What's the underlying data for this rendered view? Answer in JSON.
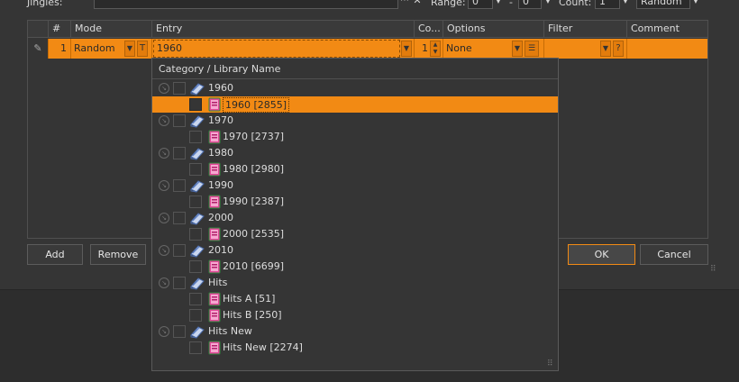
{
  "top": {
    "jingles_label": "Jingles:",
    "range_label": "Range:",
    "range_from": "0",
    "range_sep": "-",
    "range_to": "0",
    "count_label": "Count:",
    "count_value": "1",
    "mode_value": "Random"
  },
  "grid": {
    "headers": {
      "num": "#",
      "mode": "Mode",
      "entry": "Entry",
      "count": "Co...",
      "options": "Options",
      "filter": "Filter",
      "comment": "Comment"
    },
    "row": {
      "num": "1",
      "mode": "Random",
      "type": "T",
      "entry": "1960",
      "count": "1",
      "options": "None",
      "filter_button": "?"
    }
  },
  "buttons": {
    "add": "Add",
    "remove": "Remove",
    "ok": "OK",
    "cancel": "Cancel"
  },
  "dropdown": {
    "header": "Category / Library Name",
    "items": [
      {
        "label": "1960",
        "kind": "category"
      },
      {
        "label": "1960 [2855]",
        "kind": "library",
        "selected": true
      },
      {
        "label": "1970",
        "kind": "category"
      },
      {
        "label": "1970 [2737]",
        "kind": "library"
      },
      {
        "label": "1980",
        "kind": "category"
      },
      {
        "label": "1980 [2980]",
        "kind": "library"
      },
      {
        "label": "1990",
        "kind": "category"
      },
      {
        "label": "1990 [2387]",
        "kind": "library"
      },
      {
        "label": "2000",
        "kind": "category"
      },
      {
        "label": "2000 [2535]",
        "kind": "library"
      },
      {
        "label": "2010",
        "kind": "category"
      },
      {
        "label": "2010 [6699]",
        "kind": "library"
      },
      {
        "label": "Hits",
        "kind": "category"
      },
      {
        "label": "Hits A [51]",
        "kind": "library"
      },
      {
        "label": "Hits B [250]",
        "kind": "library"
      },
      {
        "label": "Hits New",
        "kind": "category"
      },
      {
        "label": "Hits New [2274]",
        "kind": "library"
      }
    ]
  },
  "colors": {
    "accent": "#f28a14",
    "background": "#353535",
    "text": "#dcdcdc"
  }
}
